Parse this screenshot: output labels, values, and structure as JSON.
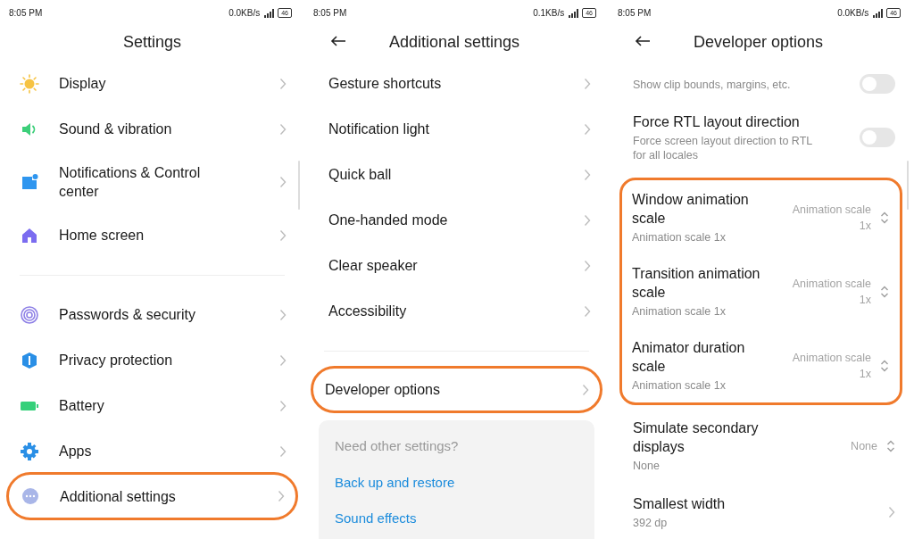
{
  "panels": [
    {
      "status": {
        "time": "8:05 PM",
        "speed": "0.0KB/s",
        "battery": "46"
      },
      "title": "Settings",
      "back": false,
      "scrollbar": true,
      "sections": [
        {
          "kind": "list",
          "divider": false,
          "highlighted": false,
          "items": [
            {
              "kind": "nav",
              "label": "Display",
              "color": "#f6c343",
              "highlighted": false
            },
            {
              "kind": "nav",
              "label": "Sound & vibration",
              "color": "#3dcf7a",
              "highlighted": false
            },
            {
              "kind": "nav",
              "label": "Notifications & Control center",
              "color": "#2f96ef",
              "highlighted": false
            },
            {
              "kind": "nav",
              "label": "Home screen",
              "color": "#7b6cf0",
              "highlighted": false
            }
          ]
        },
        {
          "kind": "list",
          "divider": true,
          "highlighted": false,
          "items": [
            {
              "kind": "nav",
              "label": "Passwords & security",
              "color": "#8e80e6",
              "highlighted": false
            },
            {
              "kind": "nav",
              "label": "Privacy protection",
              "color": "#2a8fe6",
              "highlighted": false
            },
            {
              "kind": "nav",
              "label": "Battery",
              "color": "#35d07a",
              "highlighted": false
            },
            {
              "kind": "nav",
              "label": "Apps",
              "color": "#2a8fe6",
              "highlighted": false
            },
            {
              "kind": "nav",
              "label": "Additional settings",
              "color": "#a9b6e8",
              "highlighted": true
            }
          ]
        }
      ]
    },
    {
      "status": {
        "time": "8:05 PM",
        "speed": "0.1KB/s",
        "battery": "46"
      },
      "title": "Additional settings",
      "back": true,
      "scrollbar": false,
      "sections": [
        {
          "kind": "list",
          "divider": false,
          "highlighted": false,
          "items": [
            {
              "kind": "nav",
              "label": "Gesture shortcuts",
              "highlighted": false
            },
            {
              "kind": "nav",
              "label": "Notification light",
              "highlighted": false
            },
            {
              "kind": "nav",
              "label": "Quick ball",
              "highlighted": false
            },
            {
              "kind": "nav",
              "label": "One-handed mode",
              "highlighted": false
            },
            {
              "kind": "nav",
              "label": "Clear speaker",
              "highlighted": false
            },
            {
              "kind": "nav",
              "label": "Accessibility",
              "highlighted": false
            }
          ]
        },
        {
          "kind": "list",
          "divider": true,
          "highlighted": false,
          "items": [
            {
              "kind": "nav",
              "label": "Developer options",
              "highlighted": true
            }
          ]
        },
        {
          "kind": "card",
          "divider": false,
          "highlighted": false,
          "heading": "Need other settings?",
          "links": [
            "Back up and restore",
            "Sound effects"
          ]
        }
      ]
    },
    {
      "status": {
        "time": "8:05 PM",
        "speed": "0.0KB/s",
        "battery": "46"
      },
      "title": "Developer options",
      "back": true,
      "scrollbar": true,
      "sections": [
        {
          "kind": "list",
          "divider": false,
          "highlighted": false,
          "items": [
            {
              "kind": "toggle",
              "summary": "Show clip bounds, margins, etc.",
              "on": false,
              "highlighted": false
            },
            {
              "kind": "toggle",
              "label": "Force RTL layout direction",
              "summary": "Force screen layout direction to RTL for all locales",
              "on": false,
              "highlighted": false
            }
          ]
        },
        {
          "kind": "list",
          "divider": false,
          "highlighted": true,
          "items": [
            {
              "kind": "select",
              "label": "Window animation scale",
              "summary": "Animation scale 1x",
              "value": "Animation scale 1x",
              "highlighted": false
            },
            {
              "kind": "select",
              "label": "Transition animation scale",
              "summary": "Animation scale 1x",
              "value": "Animation scale 1x",
              "highlighted": false
            },
            {
              "kind": "select",
              "label": "Animator duration scale",
              "summary": "Animation scale 1x",
              "value": "Animation scale 1x",
              "highlighted": false
            }
          ]
        },
        {
          "kind": "list",
          "divider": false,
          "highlighted": false,
          "items": [
            {
              "kind": "select",
              "label": "Simulate secondary displays",
              "summary": "None",
              "value": "None",
              "highlighted": false
            },
            {
              "kind": "nav",
              "label": "Smallest width",
              "summary": "392 dp",
              "highlighted": false
            }
          ]
        }
      ]
    }
  ]
}
